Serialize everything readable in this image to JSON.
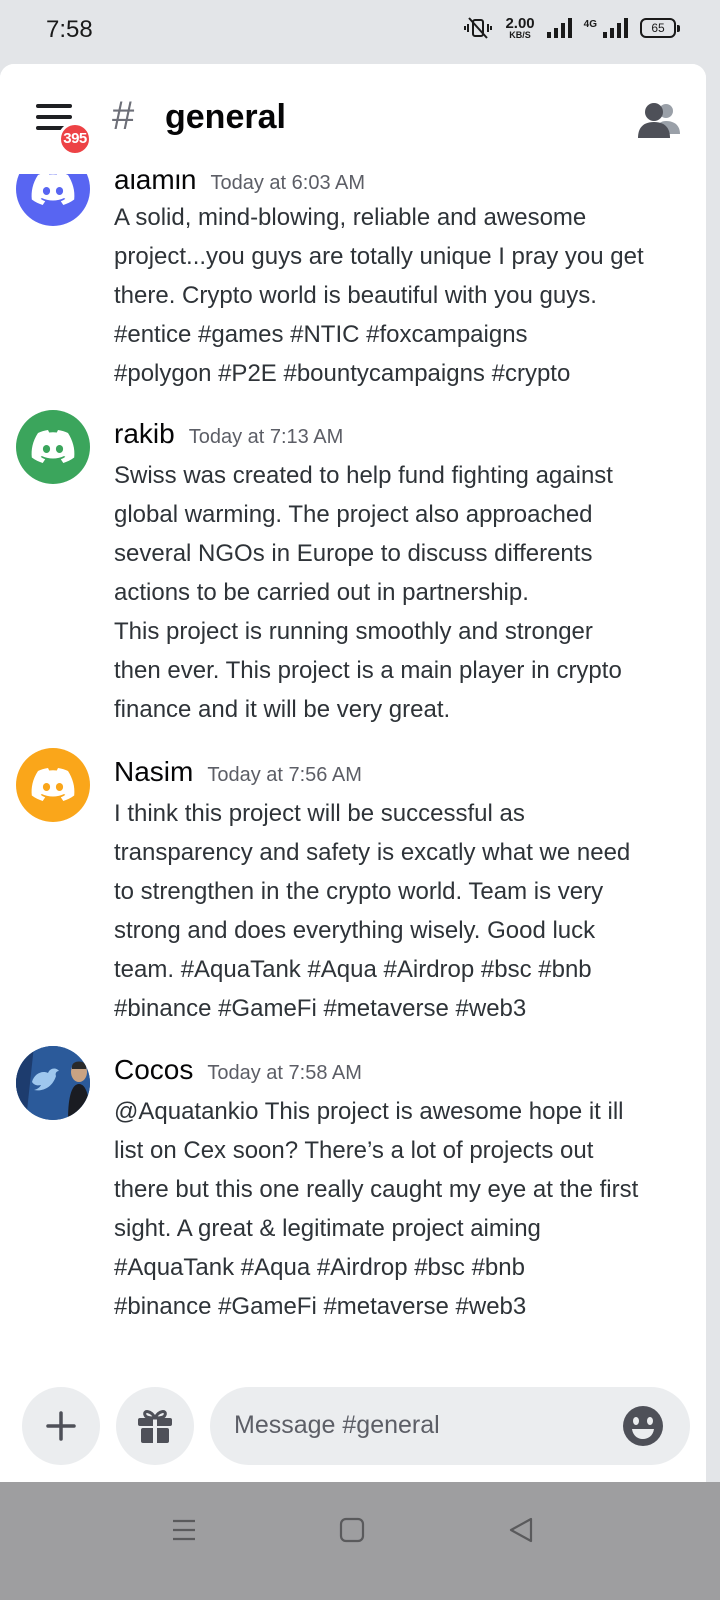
{
  "status_bar": {
    "time": "7:58",
    "net_speed_value": "2.00",
    "net_speed_unit": "KB/S",
    "net_type": "4G",
    "battery": "65"
  },
  "header": {
    "menu_badge": "395",
    "hash": "#",
    "channel": "general"
  },
  "messages": [
    {
      "author": "alamin",
      "time": "Today at 6:03 AM",
      "avatar_color": "#5865f2",
      "lines": [
        "A solid, mind-blowing, reliable and awesome",
        "project...you guys are totally unique I pray you get",
        "there. Crypto world is beautiful with you guys.",
        "#entice #games #NTIC #foxcampaigns",
        "#polygon #P2E #bountycampaigns #crypto"
      ]
    },
    {
      "author": "rakib",
      "time": "Today at 7:13 AM",
      "avatar_color": "#3ba55c",
      "lines": [
        "Swiss was created to help fund  fighting against",
        "global warming. The project also approached",
        "several NGOs in Europe to discuss differents",
        "actions to be carried out in partnership.",
        "This project is running smoothly and stronger",
        "then ever. This project is a main player in crypto",
        "finance and it will be very great."
      ]
    },
    {
      "author": "Nasim",
      "time": "Today at 7:56 AM",
      "avatar_color": "#faa61a",
      "lines": [
        "I think this project will be successful as",
        "transparency and safety is excatly what we need",
        "to strengthen in the crypto world. Team is very",
        "strong and does everything wisely. Good luck",
        "team. #AquaTank #Aqua #Airdrop #bsc #bnb",
        "#binance #GameFi #metaverse #web3"
      ]
    },
    {
      "author": "Cocos",
      "time": "Today at 7:58 AM",
      "avatar_color": "#2f6fb5",
      "lines": [
        "@Aquatankio This project is awesome hope it ill",
        "list on Cex soon? There’s a lot of projects out",
        "there but this one really caught my eye at the first",
        "sight. A great & legitimate project aiming",
        "#AquaTank #Aqua #Airdrop #bsc #bnb",
        "#binance #GameFi #metaverse #web3"
      ]
    }
  ],
  "composer": {
    "placeholder": "Message #general",
    "add_icon": "plus-icon",
    "gift_icon": "gift-icon",
    "emoji_icon": "smiley-icon"
  },
  "navbar": {
    "icons": [
      "menu-icon",
      "home-square-icon",
      "back-triangle-icon"
    ]
  }
}
